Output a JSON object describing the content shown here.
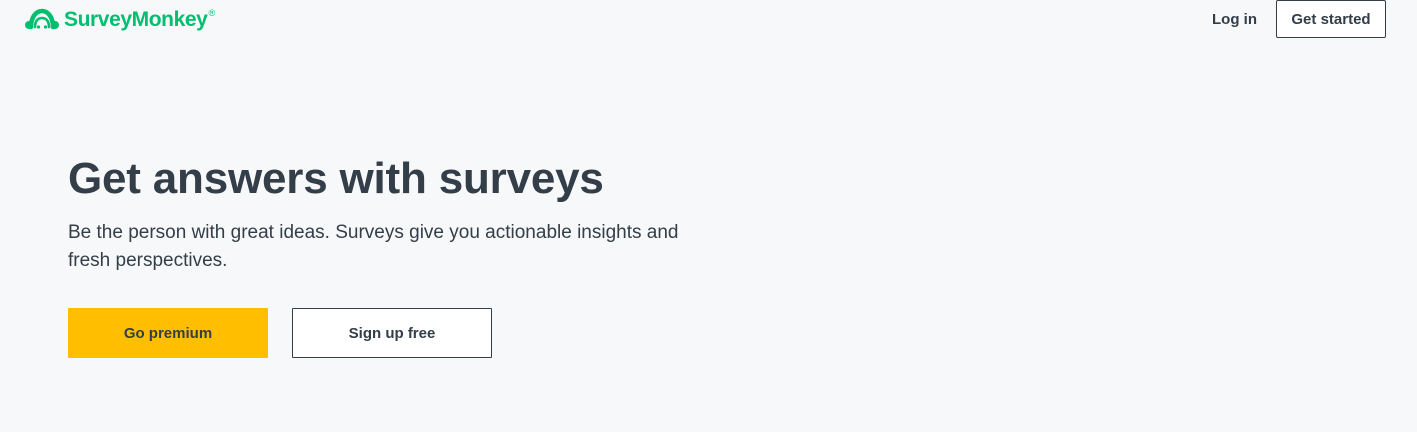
{
  "header": {
    "logo_text": "SurveyMonkey",
    "logo_mark": "®",
    "logo_icon": "surveymonkey-logo-icon",
    "login_label": "Log in",
    "get_started_label": "Get started"
  },
  "hero": {
    "title": "Get answers with surveys",
    "subtitle": "Be the person with great ideas. Surveys give you actionable insights and fresh perspectives."
  },
  "cta": {
    "premium_label": "Go premium",
    "signup_label": "Sign up free"
  },
  "colors": {
    "background": "#f7f8fa",
    "brand_green": "#00bf6f",
    "text_dark": "#333e48",
    "premium_yellow": "#ffbf00",
    "white": "#ffffff"
  }
}
